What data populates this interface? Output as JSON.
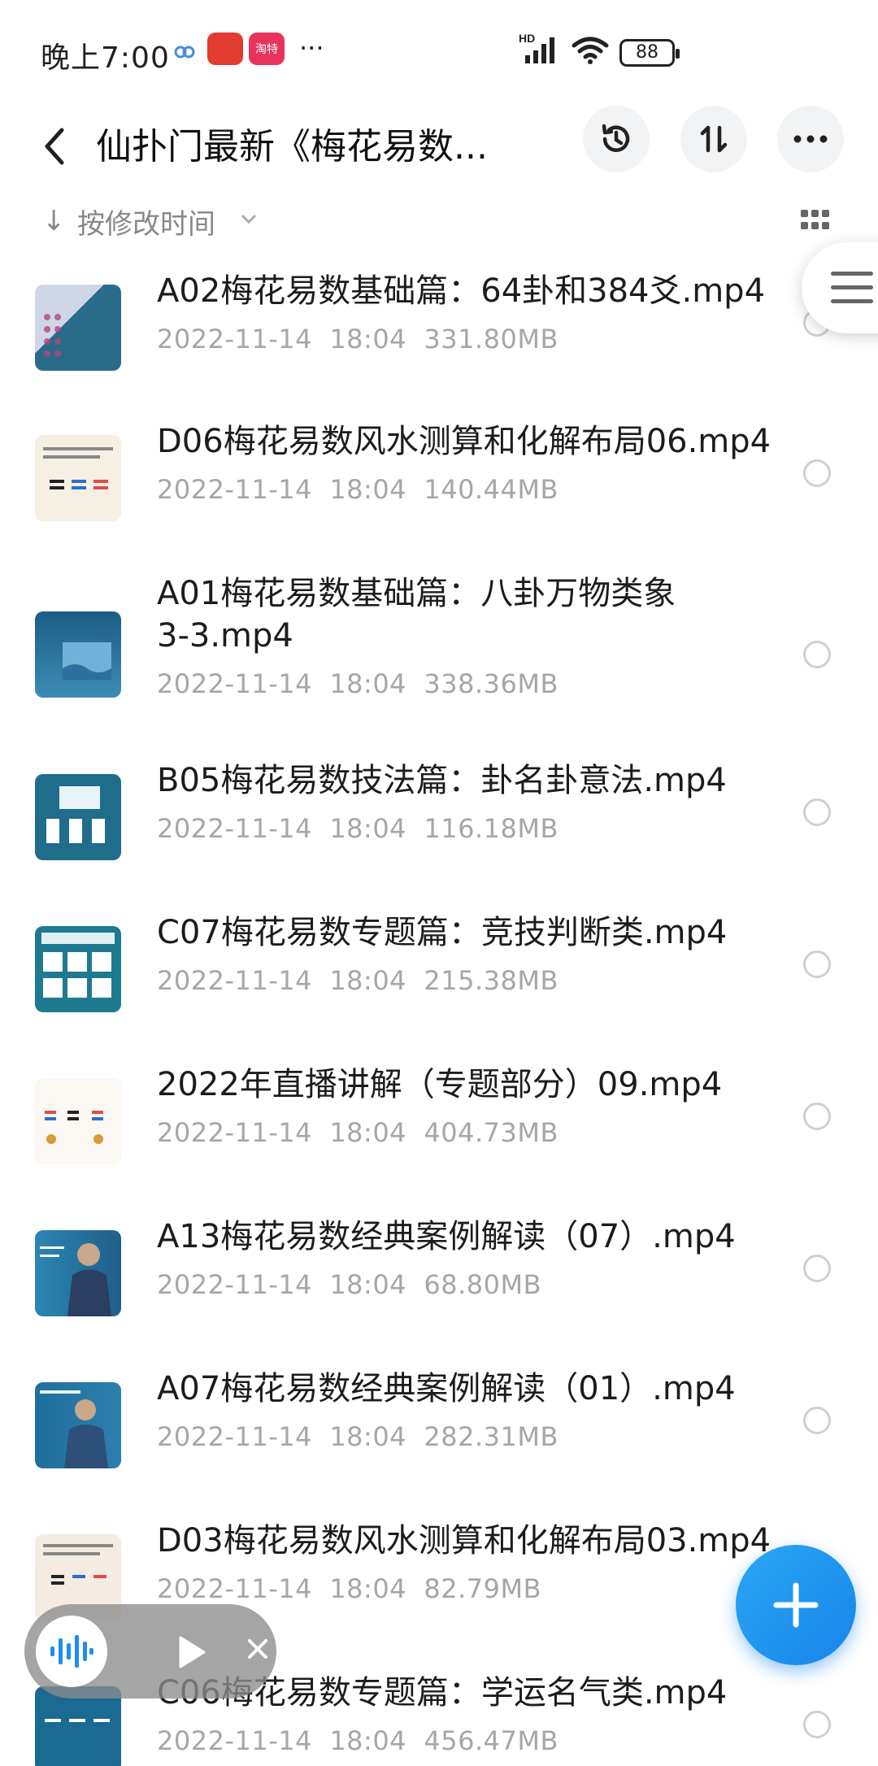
{
  "status_bar": {
    "time": "晚上7:00",
    "app2_label": "淘特",
    "battery": "88",
    "network": "HD"
  },
  "header": {
    "title": "仙扑门最新《梅花易数..."
  },
  "sort": {
    "label": "按修改时间"
  },
  "files": [
    {
      "name": "A02梅花易数基础篇：64卦和384爻.mp4",
      "date": "2022-11-14",
      "time": "18:04",
      "size": "331.80MB"
    },
    {
      "name": "D06梅花易数风水测算和化解布局06.mp4",
      "date": "2022-11-14",
      "time": "18:04",
      "size": "140.44MB"
    },
    {
      "name": "A01梅花易数基础篇：八卦万物类象3-3.mp4",
      "name_line1": "A01梅花易数基础篇：八卦万物类象",
      "name_line2": "3-3.mp4",
      "date": "2022-11-14",
      "time": "18:04",
      "size": "338.36MB"
    },
    {
      "name": "B05梅花易数技法篇：卦名卦意法.mp4",
      "date": "2022-11-14",
      "time": "18:04",
      "size": "116.18MB"
    },
    {
      "name": "C07梅花易数专题篇：竞技判断类.mp4",
      "date": "2022-11-14",
      "time": "18:04",
      "size": "215.38MB"
    },
    {
      "name": "2022年直播讲解（专题部分）09.mp4",
      "date": "2022-11-14",
      "time": "18:04",
      "size": "404.73MB"
    },
    {
      "name": "A13梅花易数经典案例解读（07）.mp4",
      "date": "2022-11-14",
      "time": "18:04",
      "size": "68.80MB"
    },
    {
      "name": "A07梅花易数经典案例解读（01）.mp4",
      "date": "2022-11-14",
      "time": "18:04",
      "size": "282.31MB"
    },
    {
      "name": "D03梅花易数风水测算和化解布局03.mp4",
      "date": "2022-11-14",
      "time": "18:04",
      "size": "82.79MB"
    },
    {
      "name": "C06梅花易数专题篇：学运名气类.mp4",
      "date": "2022-11-14",
      "time": "18:04",
      "size": "456.47MB"
    }
  ],
  "colors": {
    "accent": "#1e8ef0",
    "meta_text": "#a6a6a6"
  }
}
